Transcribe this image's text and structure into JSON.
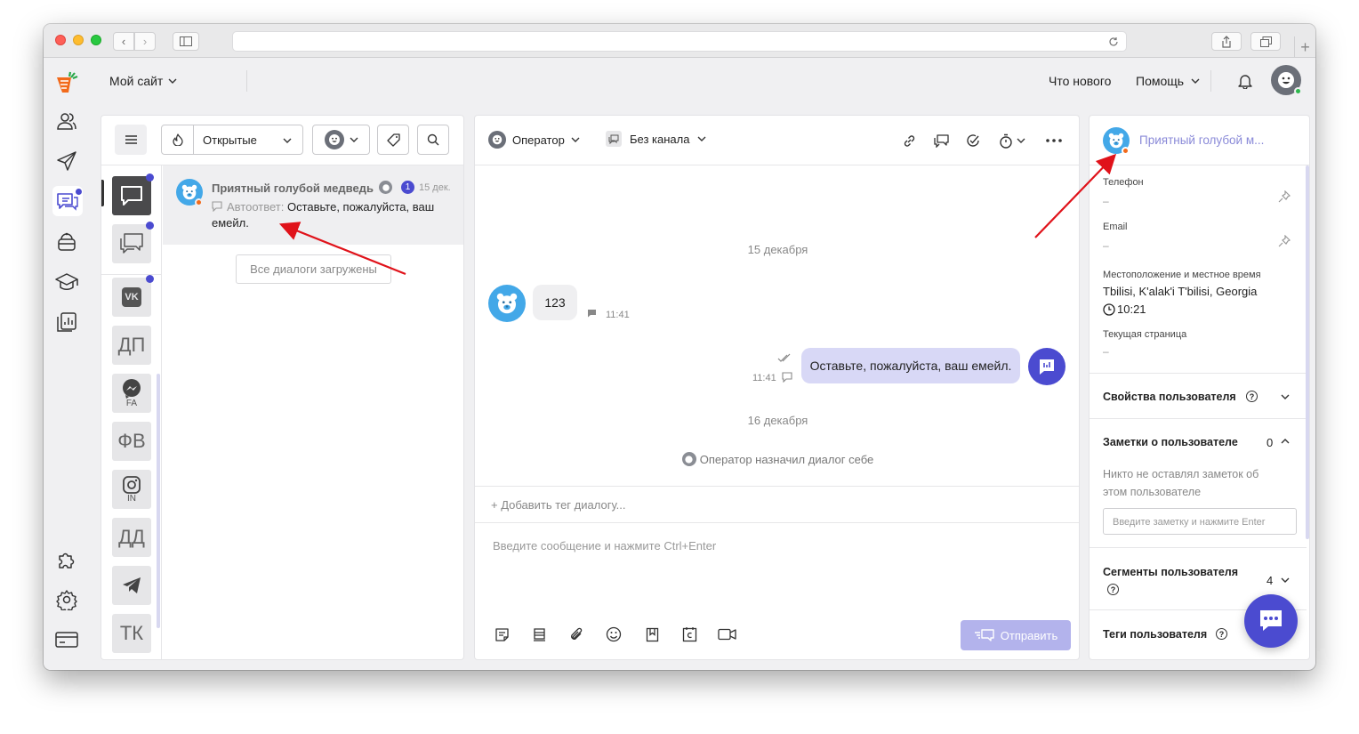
{
  "site_selector": "Мой сайт",
  "topbar": {
    "whats_new": "Что нового",
    "help": "Помощь"
  },
  "list": {
    "filter_label": "Открытые",
    "loaded_all": "Все диалоги загружены",
    "item": {
      "name": "Приятный голубой медведь",
      "unread": "1",
      "date": "15 дек.",
      "prefix": "Автоответ:",
      "text": "Оставьте, пожалуйста, ваш емейл."
    }
  },
  "channels": [
    {
      "label": "ДП"
    },
    {
      "label": "FA"
    },
    {
      "label": "ФВ"
    },
    {
      "label": "IN"
    },
    {
      "label": "ДД"
    },
    {
      "label": "ТК"
    }
  ],
  "chat": {
    "operator_label": "Оператор",
    "channel_label": "Без канала",
    "date1": "15 декабря",
    "msg_in": {
      "text": "123",
      "time": "11:41"
    },
    "msg_out": {
      "text": "Оставьте, пожалуйста, ваш емейл.",
      "time": "11:41"
    },
    "date2": "16 декабря",
    "system": "Оператор назначил диалог себе",
    "add_tag": "+ Добавить тег диалогу...",
    "input_placeholder": "Введите сообщение и нажмите Ctrl+Enter",
    "send": "Отправить"
  },
  "user": {
    "name": "Приятный голубой м...",
    "phone_label": "Телефон",
    "phone_value": "–",
    "email_label": "Email",
    "email_value": "–",
    "location_label": "Местоположение и местное время",
    "location_value": "Tbilisi, K'alak'i T'bilisi, Georgia",
    "local_time": "10:21",
    "page_label": "Текущая страница",
    "page_value": "–",
    "props_title": "Свойства пользователя",
    "notes_title": "Заметки о пользователе",
    "notes_count": "0",
    "notes_empty": "Никто не оставлял заметок об этом пользователе",
    "note_placeholder": "Введите заметку и нажмите Enter",
    "segments_title": "Сегменты пользователя",
    "segments_count": "4",
    "tags_title": "Теги пользователя"
  },
  "colors": {
    "accent": "#4b4bd0",
    "bubble_out": "#d8d8f6",
    "bear": "#43a8e8",
    "arrow": "#e0121a",
    "send_btn": "#b3b3ec"
  }
}
